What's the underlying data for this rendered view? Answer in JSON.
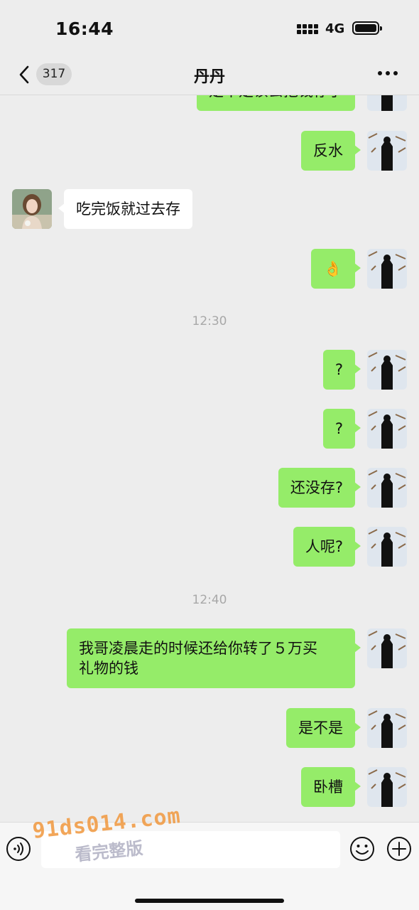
{
  "status_bar": {
    "time": "16:44",
    "network": "4G"
  },
  "nav": {
    "unread_count": "317",
    "title": "丹丹"
  },
  "messages": [
    {
      "text": "是不是该去把钱存了"
    },
    {
      "text": "反水"
    },
    {
      "text": "吃完饭就过去存"
    },
    {
      "text": "👌"
    },
    {
      "time": "12:30"
    },
    {
      "text": "?"
    },
    {
      "text": "?"
    },
    {
      "text": "还没存?"
    },
    {
      "text": "人呢?"
    },
    {
      "time": "12:40"
    },
    {
      "text": "我哥凌晨走的时候还给你转了５万买礼物的钱",
      "line1": "我哥凌晨走的时候还给你转了５万买",
      "line2": "礼物的钱"
    },
    {
      "text": "是不是"
    },
    {
      "text": "卧槽"
    }
  ],
  "input": {
    "placeholder": ""
  },
  "watermark": {
    "url": "91ds014.com",
    "caption": "看完整版"
  },
  "colors": {
    "self_bubble": "#95ec69",
    "other_bubble": "#ffffff",
    "background": "#ededed"
  }
}
